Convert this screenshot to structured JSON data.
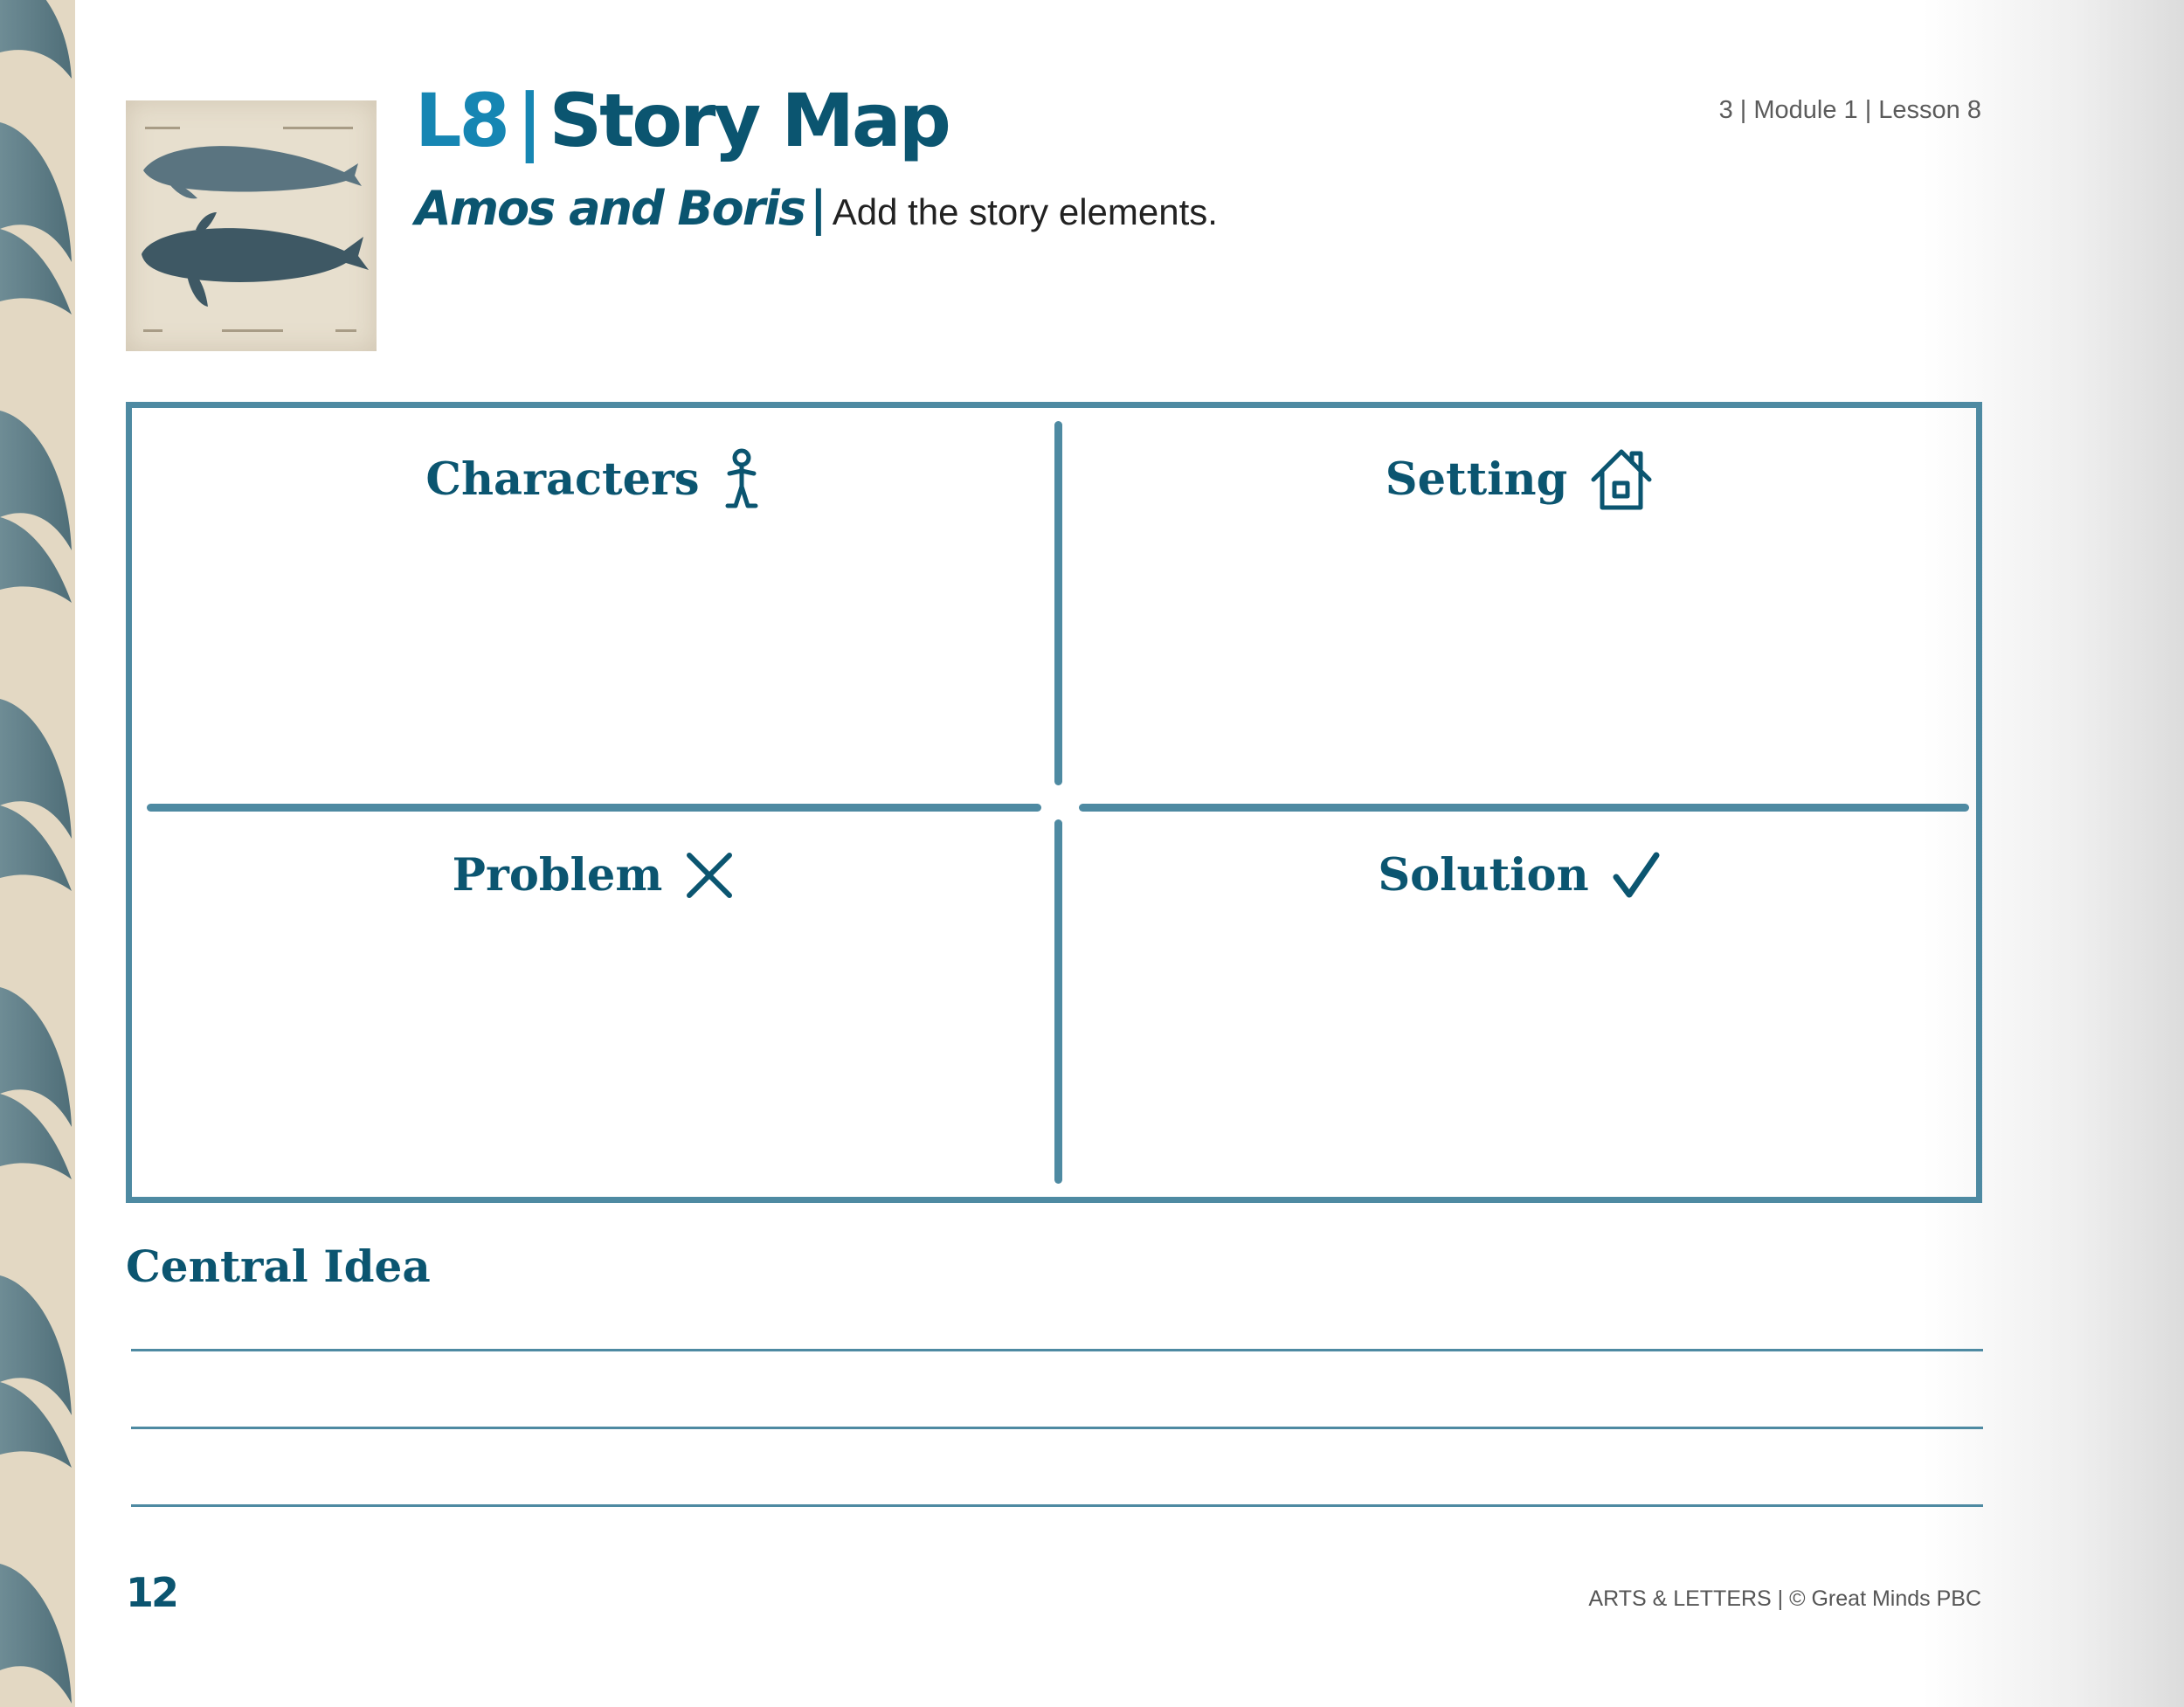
{
  "header": {
    "lesson_code": "L8",
    "separator": "|",
    "title": "Story Map",
    "book_title": "Amos and Boris",
    "book_separator": "|",
    "instruction": "Add the story elements.",
    "lesson_ref": "3 | Module 1 | Lesson 8"
  },
  "thumbnail": {
    "icon": "whale-illustration-icon"
  },
  "story_map": {
    "characters": {
      "label": "Characters",
      "icon": "stick-figure-icon"
    },
    "setting": {
      "label": "Setting",
      "icon": "house-icon"
    },
    "problem": {
      "label": "Problem",
      "icon": "x-mark-icon"
    },
    "solution": {
      "label": "Solution",
      "icon": "checkmark-icon"
    }
  },
  "central_idea": {
    "label": "Central Idea",
    "lines": 3
  },
  "footer": {
    "page_number": "12",
    "credit": "ARTS & LETTERS | © Great Minds PBC"
  },
  "colors": {
    "heading": "#0b5570",
    "accent": "#1686b3",
    "border": "#4e8aa2",
    "edge_strip": "#e3d8c3",
    "whale_tail": "#5d7c86"
  }
}
